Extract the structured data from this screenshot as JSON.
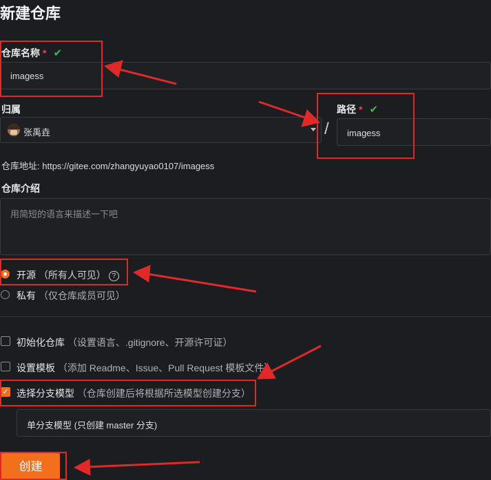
{
  "page": {
    "title": "新建仓库"
  },
  "repo_name": {
    "label": "仓库名称",
    "required": "*",
    "value": "imagess"
  },
  "owner": {
    "label": "归属",
    "value": "张禹垚"
  },
  "path": {
    "label": "路径",
    "required": "*",
    "separator": "/",
    "value": "imagess"
  },
  "repo_url": {
    "label": "仓库地址:",
    "value": "https://gitee.com/zhangyuyao0107/imagess"
  },
  "description": {
    "label": "仓库介绍",
    "placeholder": "用简短的语言来描述一下吧"
  },
  "visibility": {
    "options": [
      {
        "label": "开源",
        "hint": "（所有人可见）",
        "selected": true
      },
      {
        "label": "私有",
        "hint": "（仅仓库成员可见）",
        "selected": false
      }
    ]
  },
  "init_options": [
    {
      "label": "初始化仓库",
      "hint": "（设置语言、.gitignore、开源许可证）",
      "checked": false
    },
    {
      "label": "设置模板",
      "hint": "（添加 Readme、Issue、Pull Request 模板文件）",
      "checked": false
    },
    {
      "label": "选择分支模型",
      "hint": "（仓库创建后将根据所选模型创建分支）",
      "checked": true
    }
  ],
  "branch_model": {
    "value": "单分支模型 (只创建 master 分支)"
  },
  "submit": {
    "label": "创建"
  },
  "colors": {
    "accent": "#f2701b",
    "annotation": "#e02a2a",
    "success": "#3fb950"
  }
}
